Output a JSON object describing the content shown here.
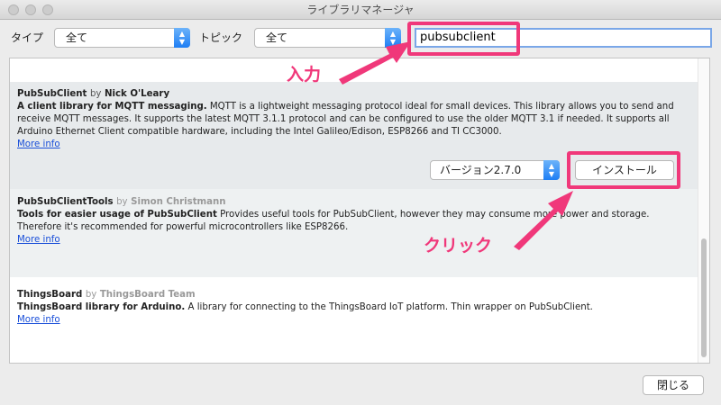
{
  "window": {
    "title": "ライブラリマネージャ"
  },
  "toolbar": {
    "type_label": "タイプ",
    "type_value": "全て",
    "topic_label": "トピック",
    "topic_value": "全て",
    "search_value": "pubsubclient"
  },
  "libraries": [
    {
      "name": "PubSubClient",
      "by": "by",
      "author": "Nick O'Leary",
      "summary": "A client library for MQTT messaging.",
      "description": "MQTT is a lightweight messaging protocol ideal for small devices. This library allows you to send and receive MQTT messages. It supports the latest MQTT 3.1.1 protocol and can be configured to use the older MQTT 3.1 if needed. It supports all Arduino Ethernet Client compatible hardware, including the Intel Galileo/Edison, ESP8266 and TI CC3000.",
      "more_info": "More info",
      "version": "バージョン2.7.0",
      "install_label": "インストール"
    },
    {
      "name": "PubSubClientTools",
      "by": "by",
      "author": "Simon Christmann",
      "summary": "Tools for easier usage of PubSubClient",
      "description": "Provides useful tools for PubSubClient, however they may consume more power and storage. Therefore it's recommended for powerful microcontrollers like ESP8266.",
      "more_info": "More info"
    },
    {
      "name": "ThingsBoard",
      "by": "by",
      "author": "ThingsBoard Team",
      "summary": "ThingsBoard library for Arduino.",
      "description": "A library for connecting to the ThingsBoard IoT platform. Thin wrapper on PubSubClient.",
      "more_info": "More info"
    }
  ],
  "footer": {
    "close_label": "閉じる"
  },
  "annotations": {
    "input": "入力",
    "click": "クリック"
  },
  "colors": {
    "highlight": "#f0387a",
    "link": "#1a4fd9",
    "accent": "#1e7ef4"
  }
}
